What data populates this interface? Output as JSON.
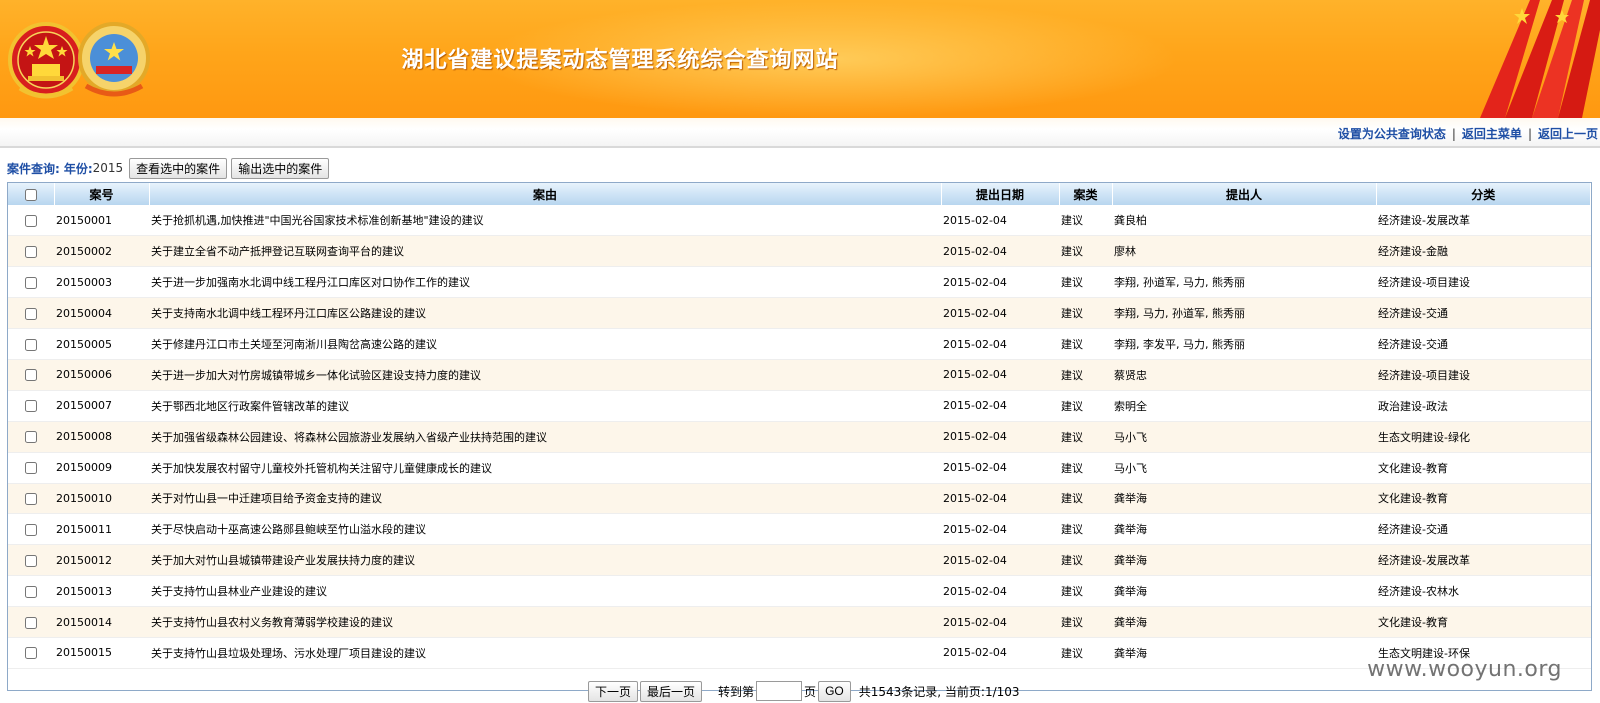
{
  "header": {
    "title": "湖北省建议提案动态管理系统综合查询网站"
  },
  "topnav": {
    "links": [
      "设置为公共查询状态",
      "返回主菜单",
      "返回上一页"
    ]
  },
  "toolbar": {
    "query_label": "案件查询:",
    "year_label": "年份:",
    "year_value": "2015",
    "view_selected_label": "查看选中的案件",
    "export_selected_label": "输出选中的案件"
  },
  "table": {
    "columns": [
      "案号",
      "案由",
      "提出日期",
      "案类",
      "提出人",
      "分类"
    ],
    "rows": [
      {
        "id": "20150001",
        "subject": "关于抢抓机遇,加快推进\"中国光谷国家技术标准创新基地\"建设的建议",
        "date": "2015-02-04",
        "type": "建议",
        "proposer": "龚良柏",
        "category": "经济建设-发展改革"
      },
      {
        "id": "20150002",
        "subject": "关于建立全省不动产抵押登记互联网查询平台的建议",
        "date": "2015-02-04",
        "type": "建议",
        "proposer": "廖林",
        "category": "经济建设-金融"
      },
      {
        "id": "20150003",
        "subject": "关于进一步加强南水北调中线工程丹江口库区对口协作工作的建议",
        "date": "2015-02-04",
        "type": "建议",
        "proposer": "李翔, 孙道军, 马力, 熊秀丽",
        "category": "经济建设-项目建设"
      },
      {
        "id": "20150004",
        "subject": "关于支持南水北调中线工程环丹江口库区公路建设的建议",
        "date": "2015-02-04",
        "type": "建议",
        "proposer": "李翔, 马力, 孙道军, 熊秀丽",
        "category": "经济建设-交通"
      },
      {
        "id": "20150005",
        "subject": "关于修建丹江口市土关垭至河南淅川县陶岔高速公路的建议",
        "date": "2015-02-04",
        "type": "建议",
        "proposer": "李翔, 李发平, 马力, 熊秀丽",
        "category": "经济建设-交通"
      },
      {
        "id": "20150006",
        "subject": "关于进一步加大对竹房城镇带城乡一体化试验区建设支持力度的建议",
        "date": "2015-02-04",
        "type": "建议",
        "proposer": "蔡贤忠",
        "category": "经济建设-项目建设"
      },
      {
        "id": "20150007",
        "subject": "关于鄂西北地区行政案件管辖改革的建议",
        "date": "2015-02-04",
        "type": "建议",
        "proposer": "索明全",
        "category": "政治建设-政法"
      },
      {
        "id": "20150008",
        "subject": "关于加强省级森林公园建设、将森林公园旅游业发展纳入省级产业扶持范围的建议",
        "date": "2015-02-04",
        "type": "建议",
        "proposer": "马小飞",
        "category": "生态文明建设-绿化"
      },
      {
        "id": "20150009",
        "subject": "关于加快发展农村留守儿童校外托管机构关注留守儿童健康成长的建议",
        "date": "2015-02-04",
        "type": "建议",
        "proposer": "马小飞",
        "category": "文化建设-教育"
      },
      {
        "id": "20150010",
        "subject": "关于对竹山县一中迁建项目给予资金支持的建议",
        "date": "2015-02-04",
        "type": "建议",
        "proposer": "龚举海",
        "category": "文化建设-教育"
      },
      {
        "id": "20150011",
        "subject": "关于尽快启动十巫高速公路郧县鲍峡至竹山溢水段的建议",
        "date": "2015-02-04",
        "type": "建议",
        "proposer": "龚举海",
        "category": "经济建设-交通"
      },
      {
        "id": "20150012",
        "subject": "关于加大对竹山县城镇带建设产业发展扶持力度的建议",
        "date": "2015-02-04",
        "type": "建议",
        "proposer": "龚举海",
        "category": "经济建设-发展改革"
      },
      {
        "id": "20150013",
        "subject": "关于支持竹山县林业产业建设的建议",
        "date": "2015-02-04",
        "type": "建议",
        "proposer": "龚举海",
        "category": "经济建设-农林水"
      },
      {
        "id": "20150014",
        "subject": "关于支持竹山县农村义务教育薄弱学校建设的建议",
        "date": "2015-02-04",
        "type": "建议",
        "proposer": "龚举海",
        "category": "文化建设-教育"
      },
      {
        "id": "20150015",
        "subject": "关于支持竹山县垃圾处理场、污水处理厂项目建设的建议",
        "date": "2015-02-04",
        "type": "建议",
        "proposer": "龚举海",
        "category": "生态文明建设-环保"
      }
    ]
  },
  "pager": {
    "next_label": "下一页",
    "last_label": "最后一页",
    "goto_prefix": "转到第",
    "goto_suffix": "页",
    "go_label": "GO",
    "info": "共1543条记录, 当前页:1/103"
  },
  "watermark": "www.wooyun.org",
  "colors": {
    "banner": "#ffa51a",
    "link_blue": "#1f4fa5",
    "header_blue": "#cfe4f6",
    "alt_row": "#fdf6ea"
  }
}
